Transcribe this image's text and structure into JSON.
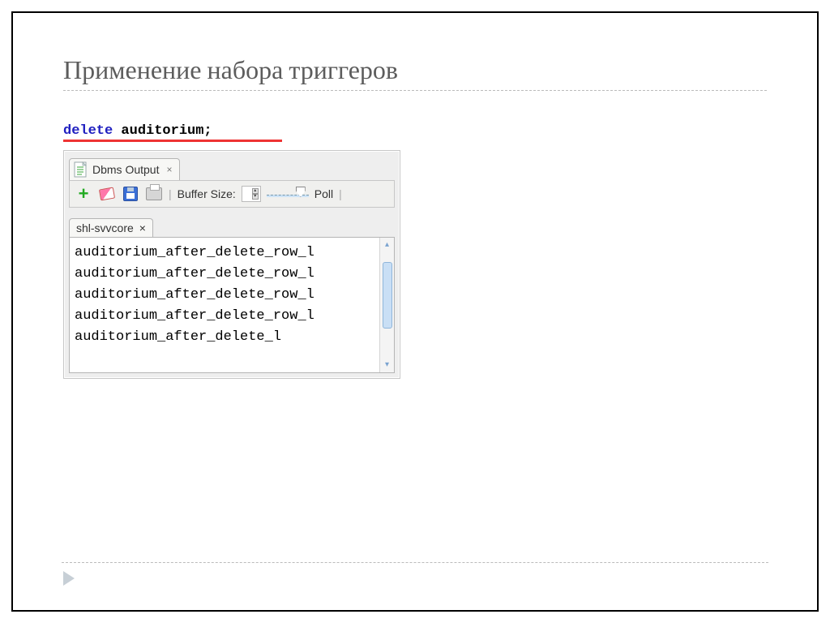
{
  "slide": {
    "title": "Применение набора триггеров"
  },
  "sql": {
    "keyword": "delete",
    "rest": " auditorium;"
  },
  "tabs": {
    "dbms_output_label": "Dbms Output",
    "close_glyph": "×"
  },
  "toolbar": {
    "buffer_label": "Buffer Size:",
    "poll_label": "Poll",
    "separator": "|"
  },
  "subtab": {
    "label": "shl-svvcore",
    "close_glyph": "×"
  },
  "output": {
    "lines": [
      "auditorium_after_delete_row_l",
      "auditorium_after_delete_row_l",
      "auditorium_after_delete_row_l",
      "auditorium_after_delete_row_l",
      "auditorium_after_delete_l"
    ]
  },
  "scroll": {
    "up": "▴",
    "down": "▾"
  }
}
